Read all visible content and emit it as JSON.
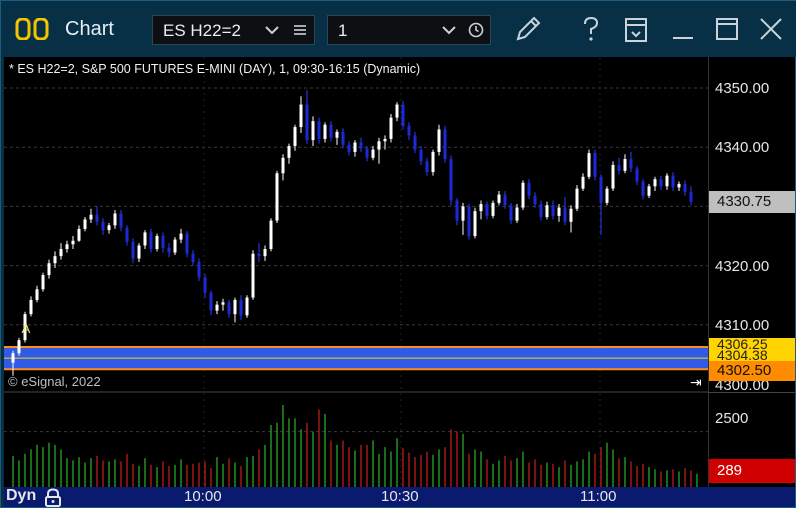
{
  "window": {
    "title": "Chart",
    "symbol": "ES H22=2",
    "interval": "1"
  },
  "chart": {
    "description": "* ES H22=2, S&P 500 FUTURES E-MINI (DAY), 1, 09:30-16:15 (Dynamic)",
    "copyright": "© eSignal, 2022",
    "marker_label": "A",
    "price_labels": [
      "4350.00",
      "4340.00",
      "4330.75",
      "4320.00",
      "4310.00",
      "4306.25",
      "4304.38",
      "4302.50",
      "4300.00"
    ],
    "volume_labels": [
      "2500",
      "289"
    ],
    "time_labels": [
      "10:00",
      "10:30",
      "11:00"
    ],
    "mode_label": "Dyn",
    "colors": {
      "up_candle": "#ffffff",
      "down_candle": "#1a2ad8",
      "band": "#2f5be8",
      "band_border": "#ff8c1a",
      "current_price_tag": "#bfbfbf",
      "volume_tag": "#d00000",
      "upper_tag": "#ffd400",
      "lower_tag": "#ff8c00"
    }
  },
  "chart_data": {
    "type": "candlestick",
    "ylim": [
      4300,
      4353
    ],
    "candles": [
      [
        4303.6,
        4305.6,
        4301.4,
        4305.2
      ],
      [
        4305.2,
        4307.8,
        4304.8,
        4307.4
      ],
      [
        4307.4,
        4312.2,
        4307.0,
        4311.8
      ],
      [
        4311.8,
        4314.8,
        4311.4,
        4314.2
      ],
      [
        4314.2,
        4316.6,
        4313.8,
        4316.0
      ],
      [
        4316.0,
        4318.8,
        4315.6,
        4318.4
      ],
      [
        4318.4,
        4321.0,
        4317.8,
        4320.4
      ],
      [
        4320.4,
        4322.4,
        4319.6,
        4321.6
      ],
      [
        4321.6,
        4323.8,
        4321.0,
        4322.8
      ],
      [
        4322.8,
        4324.2,
        4322.2,
        4323.6
      ],
      [
        4323.6,
        4325.0,
        4322.8,
        4324.2
      ],
      [
        4324.2,
        4326.8,
        4324.0,
        4326.2
      ],
      [
        4326.2,
        4328.2,
        4325.8,
        4327.8
      ],
      [
        4327.8,
        4329.6,
        4327.2,
        4328.6
      ],
      [
        4328.6,
        4330.0,
        4326.8,
        4327.4
      ],
      [
        4327.4,
        4328.0,
        4325.2,
        4326.0
      ],
      [
        4326.0,
        4327.2,
        4325.4,
        4326.8
      ],
      [
        4326.8,
        4329.4,
        4326.2,
        4328.8
      ],
      [
        4328.8,
        4329.4,
        4325.8,
        4326.4
      ],
      [
        4326.4,
        4326.8,
        4323.4,
        4324.0
      ],
      [
        4324.0,
        4324.6,
        4320.4,
        4321.2
      ],
      [
        4321.2,
        4323.8,
        4320.6,
        4323.4
      ],
      [
        4323.4,
        4326.0,
        4322.8,
        4325.6
      ],
      [
        4325.6,
        4326.2,
        4322.2,
        4322.8
      ],
      [
        4322.8,
        4325.4,
        4322.4,
        4325.0
      ],
      [
        4325.0,
        4325.6,
        4322.2,
        4323.0
      ],
      [
        4323.0,
        4323.8,
        4321.4,
        4322.2
      ],
      [
        4322.2,
        4324.8,
        4321.8,
        4324.4
      ],
      [
        4324.4,
        4326.2,
        4323.8,
        4325.4
      ],
      [
        4325.4,
        4325.8,
        4321.4,
        4322.0
      ],
      [
        4322.0,
        4322.6,
        4320.0,
        4320.6
      ],
      [
        4320.6,
        4321.2,
        4317.4,
        4318.0
      ],
      [
        4318.0,
        4318.6,
        4314.6,
        4315.4
      ],
      [
        4315.4,
        4315.8,
        4311.6,
        4312.4
      ],
      [
        4312.4,
        4314.0,
        4311.8,
        4313.4
      ],
      [
        4313.4,
        4314.4,
        4312.4,
        4313.8
      ],
      [
        4313.8,
        4314.2,
        4311.2,
        4311.8
      ],
      [
        4311.8,
        4314.6,
        4310.4,
        4314.2
      ],
      [
        4314.2,
        4315.0,
        4310.8,
        4311.6
      ],
      [
        4311.6,
        4315.0,
        4311.2,
        4314.6
      ],
      [
        4314.6,
        4322.6,
        4314.2,
        4322.0
      ],
      [
        4322.0,
        4323.8,
        4320.6,
        4321.6
      ],
      [
        4321.6,
        4323.4,
        4320.8,
        4322.8
      ],
      [
        4322.8,
        4328.0,
        4322.4,
        4327.6
      ],
      [
        4327.6,
        4336.0,
        4327.2,
        4335.6
      ],
      [
        4335.6,
        4338.8,
        4334.4,
        4338.2
      ],
      [
        4338.2,
        4340.6,
        4337.2,
        4340.2
      ],
      [
        4340.2,
        4343.8,
        4339.4,
        4343.4
      ],
      [
        4343.4,
        4348.6,
        4342.4,
        4347.2
      ],
      [
        4347.2,
        4349.6,
        4340.6,
        4341.2
      ],
      [
        4341.2,
        4345.2,
        4340.2,
        4344.4
      ],
      [
        4344.4,
        4345.0,
        4340.6,
        4341.4
      ],
      [
        4341.4,
        4344.2,
        4340.8,
        4343.8
      ],
      [
        4343.8,
        4344.4,
        4341.0,
        4341.6
      ],
      [
        4341.6,
        4343.0,
        4340.4,
        4342.6
      ],
      [
        4342.6,
        4343.2,
        4339.8,
        4340.4
      ],
      [
        4340.4,
        4341.0,
        4338.6,
        4339.2
      ],
      [
        4339.2,
        4341.2,
        4338.4,
        4340.8
      ],
      [
        4340.8,
        4341.6,
        4339.2,
        4339.8
      ],
      [
        4339.8,
        4340.2,
        4337.6,
        4338.2
      ],
      [
        4338.2,
        4340.2,
        4337.8,
        4339.6
      ],
      [
        4339.6,
        4341.6,
        4337.2,
        4341.0
      ],
      [
        4341.0,
        4342.0,
        4339.6,
        4341.4
      ],
      [
        4341.4,
        4345.6,
        4340.8,
        4345.0
      ],
      [
        4345.0,
        4347.6,
        4344.4,
        4347.2
      ],
      [
        4347.2,
        4347.8,
        4343.0,
        4343.6
      ],
      [
        4343.6,
        4344.2,
        4341.2,
        4342.0
      ],
      [
        4342.0,
        4342.6,
        4339.0,
        4339.6
      ],
      [
        4339.6,
        4340.2,
        4337.0,
        4337.6
      ],
      [
        4337.6,
        4338.2,
        4335.2,
        4335.8
      ],
      [
        4335.8,
        4339.6,
        4335.2,
        4339.2
      ],
      [
        4339.2,
        4343.8,
        4338.6,
        4343.0
      ],
      [
        4343.0,
        4343.6,
        4337.4,
        4338.0
      ],
      [
        4338.0,
        4338.6,
        4330.2,
        4331.0
      ],
      [
        4331.0,
        4331.4,
        4326.8,
        4327.6
      ],
      [
        4327.6,
        4330.6,
        4325.2,
        4330.0
      ],
      [
        4330.0,
        4330.4,
        4324.4,
        4325.0
      ],
      [
        4325.0,
        4329.8,
        4324.6,
        4329.2
      ],
      [
        4329.2,
        4331.0,
        4327.8,
        4330.4
      ],
      [
        4330.4,
        4330.8,
        4327.8,
        4328.4
      ],
      [
        4328.4,
        4331.0,
        4328.0,
        4330.6
      ],
      [
        4330.6,
        4332.6,
        4330.2,
        4332.0
      ],
      [
        4332.0,
        4332.6,
        4329.6,
        4330.2
      ],
      [
        4330.2,
        4330.6,
        4327.0,
        4327.6
      ],
      [
        4327.6,
        4330.4,
        4327.2,
        4329.8
      ],
      [
        4329.8,
        4334.4,
        4329.4,
        4334.0
      ],
      [
        4334.0,
        4334.6,
        4331.2,
        4331.8
      ],
      [
        4331.8,
        4332.4,
        4329.8,
        4330.4
      ],
      [
        4330.4,
        4331.0,
        4327.6,
        4328.2
      ],
      [
        4328.2,
        4330.8,
        4327.8,
        4330.2
      ],
      [
        4330.2,
        4331.0,
        4327.8,
        4328.4
      ],
      [
        4328.4,
        4330.4,
        4327.4,
        4329.8
      ],
      [
        4329.8,
        4331.6,
        4326.8,
        4327.4
      ],
      [
        4327.4,
        4330.2,
        4325.6,
        4329.6
      ],
      [
        4329.6,
        4333.6,
        4329.2,
        4333.0
      ],
      [
        4333.0,
        4335.6,
        4332.6,
        4335.0
      ],
      [
        4335.0,
        4339.6,
        4334.6,
        4339.0
      ],
      [
        4339.0,
        4339.6,
        4334.4,
        4335.0
      ],
      [
        4335.0,
        4335.4,
        4325.2,
        4330.6
      ],
      [
        4330.6,
        4333.4,
        4330.2,
        4333.0
      ],
      [
        4333.0,
        4337.6,
        4332.6,
        4337.0
      ],
      [
        4337.0,
        4338.2,
        4335.4,
        4336.0
      ],
      [
        4336.0,
        4338.8,
        4335.6,
        4338.0
      ],
      [
        4338.0,
        4339.2,
        4335.8,
        4336.4
      ],
      [
        4336.4,
        4336.8,
        4333.6,
        4334.2
      ],
      [
        4334.2,
        4334.6,
        4331.2,
        4331.8
      ],
      [
        4331.8,
        4333.8,
        4331.4,
        4333.4
      ],
      [
        4333.4,
        4335.0,
        4332.6,
        4334.6
      ],
      [
        4334.6,
        4335.2,
        4332.8,
        4333.4
      ],
      [
        4333.4,
        4335.6,
        4332.8,
        4335.2
      ],
      [
        4335.2,
        4335.8,
        4332.6,
        4333.2
      ],
      [
        4333.2,
        4334.2,
        4332.6,
        4333.8
      ],
      [
        4333.8,
        4334.4,
        4331.8,
        4332.4
      ],
      [
        4332.4,
        4333.4,
        4330.2,
        4330.75
      ]
    ],
    "volumes": [
      1400,
      1200,
      1500,
      1700,
      1900,
      1800,
      2000,
      1900,
      1700,
      1300,
      1200,
      1350,
      1100,
      1300,
      1400,
      1200,
      1150,
      1250,
      1150,
      1500,
      1050,
      950,
      1300,
      1000,
      900,
      1150,
      950,
      1000,
      1250,
      1000,
      1050,
      1100,
      1150,
      850,
      1350,
      1050,
      1300,
      1100,
      950,
      1350,
      1400,
      1700,
      1900,
      2800,
      2900,
      3700,
      3100,
      3100,
      2600,
      2900,
      2500,
      3500,
      3300,
      2100,
      1900,
      2100,
      1800,
      1650,
      1900,
      1900,
      2100,
      1500,
      1800,
      1600,
      2200,
      1750,
      1550,
      1350,
      1450,
      1600,
      1450,
      1700,
      1800,
      2600,
      2500,
      2400,
      1500,
      1700,
      1600,
      1250,
      1050,
      1200,
      1400,
      1200,
      1300,
      1600,
      1100,
      1250,
      1000,
      1100,
      1050,
      900,
      1200,
      1000,
      1150,
      1250,
      1600,
      1500,
      1800,
      2000,
      1700,
      1300,
      1350,
      1150,
      950,
      1050,
      900,
      800,
      700,
      750,
      800,
      700,
      850,
      750,
      600
    ],
    "band": {
      "upper": 4306.25,
      "mid": 4304.38,
      "lower": 4302.5
    },
    "marker": {
      "index": 2,
      "label": "A"
    },
    "vol_ref": 2500
  }
}
